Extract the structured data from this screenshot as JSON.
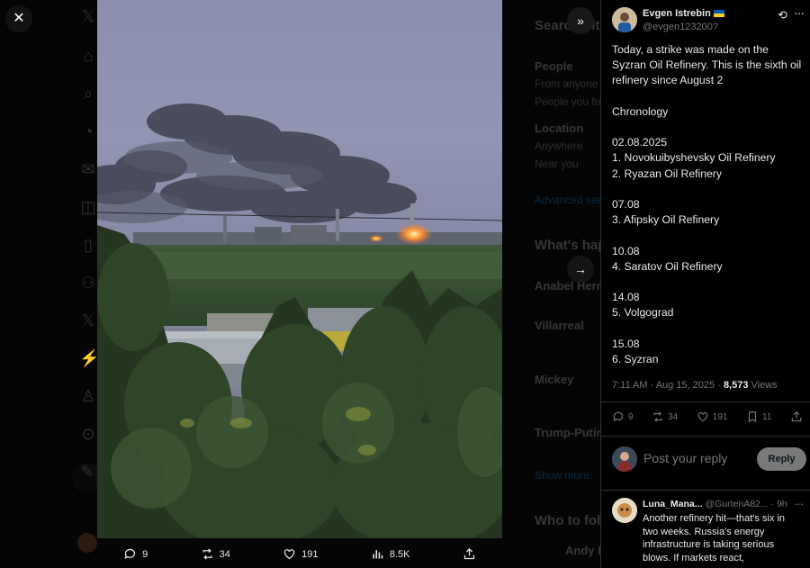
{
  "media_actions": {
    "replies": "9",
    "reposts": "34",
    "likes": "191",
    "views": "8.5K"
  },
  "post": {
    "author_name": "Evgen Istrebin",
    "author_handle": "@evgen123200?",
    "lines": [
      "Today, a strike was made on the",
      "Syzran Oil Refinery. This is the sixth oil",
      "refinery since August 2",
      "",
      "Chronology",
      "",
      "02.08.2025",
      "1. Novokuibyshevsky Oil Refinery",
      "2. Ryazan Oil Refinery",
      "",
      "07.08",
      "3. Afipsky Oil Refinery",
      "",
      "10.08",
      "4. Saratov Oil Refinery",
      "",
      "14.08",
      "5. Volgograd",
      "",
      "15.08",
      "6. Syzran"
    ],
    "timestamp": "7:11 AM · Aug 15, 2025 · ",
    "views_count": "8,573",
    "views_label": " Views",
    "actions": {
      "replies": "9",
      "reposts": "34",
      "likes": "191",
      "bookmarks": "11"
    }
  },
  "reply_box": {
    "placeholder": "Post your reply",
    "button_label": "Reply"
  },
  "comment": {
    "name": "Luna_Mana...",
    "meta": " @GurtenA82... · 9h",
    "lines": [
      "Another refinery hit—that's six in",
      "two weeks. Russia's energy",
      "infrastructure is taking serious",
      "blows. If markets react,"
    ]
  },
  "background": {
    "search_label": "Search filters",
    "people_label": "People",
    "from_anyone": "From anyone",
    "people_you_follow": "People you follow",
    "location_label": "Location",
    "anywhere": "Anywhere",
    "near_you": "Near you",
    "advanced_search": "Advanced search",
    "whats_happening": "What's happening",
    "trend1": "Anabel Hernández",
    "trend2": "Villarreal",
    "trend3": "Mickey",
    "trend4": "Trump-Putin",
    "show_more": "Show more",
    "who_to_follow": "Who to follow",
    "follow_suggestion": "Andy B"
  },
  "colors": {
    "accent": "#1d9bf0",
    "text_primary": "#e7e9ea",
    "text_secondary": "#71767b",
    "border": "#2f3336"
  }
}
